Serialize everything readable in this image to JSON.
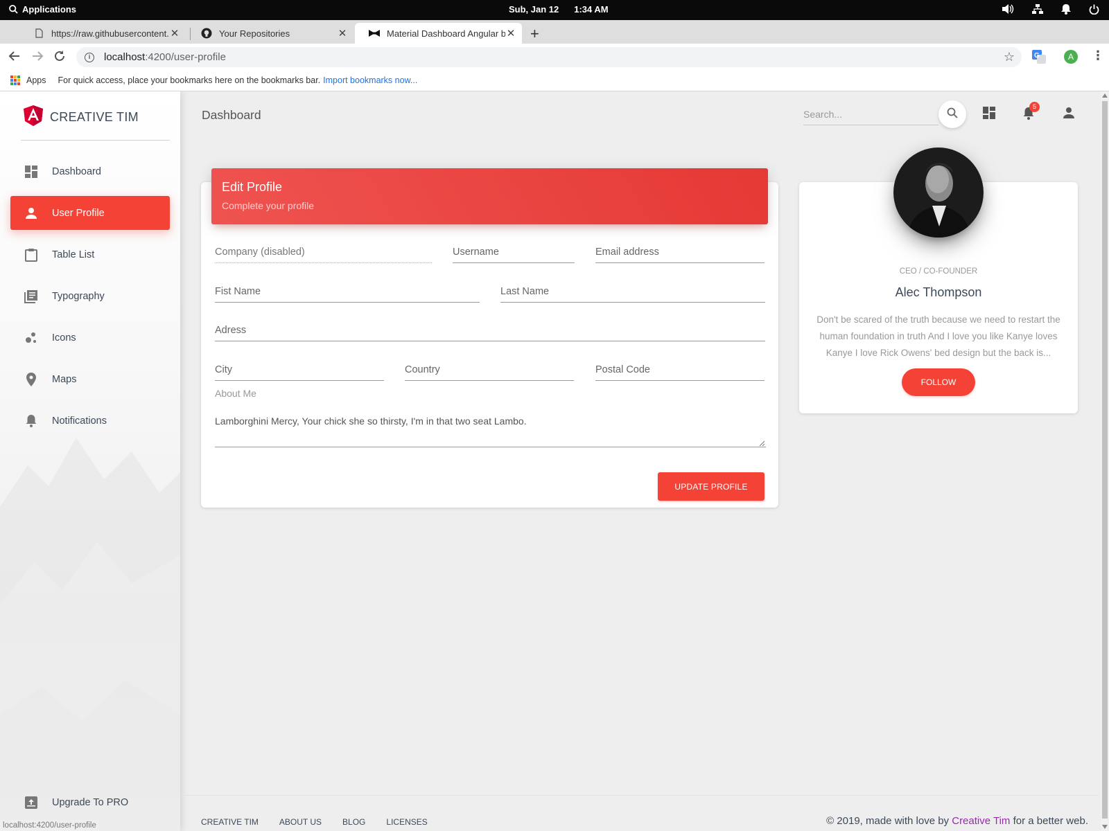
{
  "os": {
    "menu_label": "Applications",
    "date": "Sub, Jan 12",
    "time": "1:34 AM"
  },
  "browser": {
    "tabs": [
      {
        "title": "https://raw.githubusercontent.com",
        "icon": "file-icon"
      },
      {
        "title": "Your Repositories",
        "icon": "github-icon"
      },
      {
        "title": "Material Dashboard Angular by Creative Tim",
        "icon": "bowtie-icon"
      }
    ],
    "url_host": "localhost",
    "url_path": ":4200/user-profile",
    "bookmarks_apps": "Apps",
    "bookmarks_hint": "For quick access, place your bookmarks here on the bookmarks bar.",
    "bookmarks_import": "Import bookmarks now...",
    "profile_initial": "A",
    "status_url": "localhost:4200/user-profile"
  },
  "sidebar": {
    "brand": "CREATIVE TIM",
    "items": [
      {
        "label": "Dashboard",
        "icon": "dashboard-icon"
      },
      {
        "label": "User Profile",
        "icon": "person-icon"
      },
      {
        "label": "Table List",
        "icon": "clipboard-icon"
      },
      {
        "label": "Typography",
        "icon": "library-books-icon"
      },
      {
        "label": "Icons",
        "icon": "bubble-chart-icon"
      },
      {
        "label": "Maps",
        "icon": "location-pin-icon"
      },
      {
        "label": "Notifications",
        "icon": "bell-icon"
      }
    ],
    "upgrade": "Upgrade To PRO"
  },
  "topbar": {
    "title": "Dashboard",
    "search_placeholder": "Search...",
    "notification_count": "5"
  },
  "edit_profile": {
    "title": "Edit Profile",
    "subtitle": "Complete your profile",
    "fields": {
      "company": "Company (disabled)",
      "username": "Username",
      "email": "Email address",
      "first_name": "Fist Name",
      "last_name": "Last Name",
      "address": "Adress",
      "city": "City",
      "country": "Country",
      "postal": "Postal Code"
    },
    "about_label": "About Me",
    "about_value": "Lamborghini Mercy, Your chick she so thirsty, I'm in that two seat Lambo.",
    "update_button": "UPDATE PROFILE"
  },
  "profile": {
    "role": "CEO / CO-FOUNDER",
    "name": "Alec Thompson",
    "bio": "Don't be scared of the truth because we need to restart the human foundation in truth And I love you like Kanye loves Kanye I love Rick Owens' bed design but the back is...",
    "follow_button": "FOLLOW"
  },
  "footer": {
    "links": [
      "CREATIVE TIM",
      "ABOUT US",
      "BLOG",
      "LICENSES"
    ],
    "copyright_prefix": "© 2019, made with love by",
    "copyright_brand": "Creative Tim",
    "copyright_suffix": "for a better web."
  },
  "colors": {
    "accent": "#f44336",
    "brand_link": "#9c27b0"
  }
}
